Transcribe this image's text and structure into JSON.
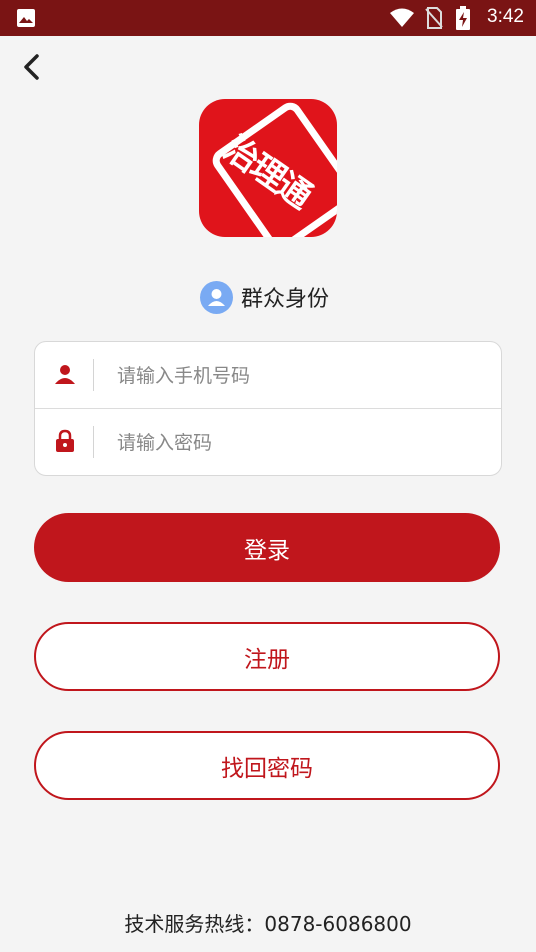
{
  "status_bar": {
    "time": "3:42"
  },
  "identity": {
    "label": "群众身份"
  },
  "form": {
    "phone_placeholder": "请输入手机号码",
    "password_placeholder": "请输入密码"
  },
  "buttons": {
    "login": "登录",
    "register": "注册",
    "forgot": "找回密码"
  },
  "footer": {
    "hotline": "技术服务热线：0878-6086800"
  },
  "logo": {
    "text": "治理通"
  },
  "colors": {
    "status_bar": "#7a1414",
    "primary": "#c0161c",
    "avatar": "#79aaf3",
    "background": "#f4f4f4"
  }
}
